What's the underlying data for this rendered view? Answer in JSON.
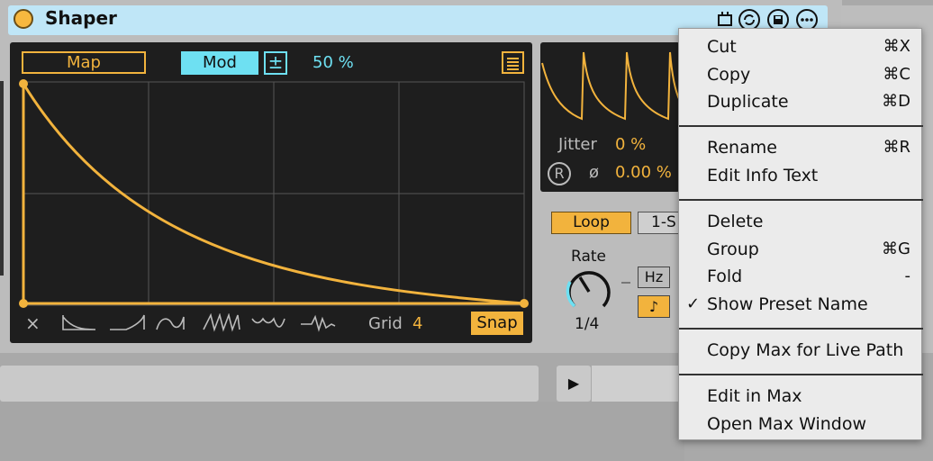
{
  "device": {
    "title": "Shaper",
    "map_label": "Map",
    "mod_label": "Mod",
    "plus_symbol": "±",
    "mod_amount": "50 %",
    "grid_label": "Grid",
    "grid_value": "4",
    "snap_label": "Snap",
    "clear_symbol": "×"
  },
  "lfo": {
    "jitter_label": "Jitter",
    "jitter_value": "0 %",
    "reset_symbol": "R",
    "phase_symbol": "ø",
    "phase_value": "0.00 %",
    "loop_label": "Loop",
    "oneshot_label": "1-S",
    "rate_label": "Rate",
    "rate_value": "1/4",
    "hz_label": "Hz",
    "note_symbol": "♪"
  },
  "transport": {
    "play_symbol": "▶"
  },
  "colors": {
    "accent": "#f2b33d",
    "mod": "#6ee0f2",
    "title_bar": "#bfe6f7"
  },
  "context_menu": {
    "items": [
      {
        "label": "Cut",
        "shortcut": "⌘X",
        "checked": false
      },
      {
        "label": "Copy",
        "shortcut": "⌘C",
        "checked": false
      },
      {
        "label": "Duplicate",
        "shortcut": "⌘D",
        "checked": false
      },
      {
        "label": "Rename",
        "shortcut": "⌘R",
        "checked": false
      },
      {
        "label": "Edit Info Text",
        "shortcut": "",
        "checked": false
      },
      {
        "label": "Delete",
        "shortcut": "",
        "checked": false
      },
      {
        "label": "Group",
        "shortcut": "⌘G",
        "checked": false
      },
      {
        "label": "Fold",
        "shortcut": "-",
        "checked": false
      },
      {
        "label": "Show Preset Name",
        "shortcut": "",
        "checked": true
      },
      {
        "label": "Copy Max for Live Path",
        "shortcut": "",
        "checked": false
      },
      {
        "label": "Edit in Max",
        "shortcut": "",
        "checked": false
      },
      {
        "label": "Open Max Window",
        "shortcut": "",
        "checked": false
      }
    ],
    "check_symbol": "✓"
  }
}
